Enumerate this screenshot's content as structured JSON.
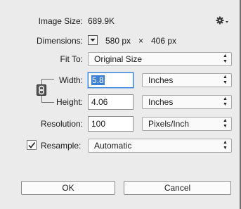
{
  "image_size": {
    "label": "Image Size:",
    "value": "689.9K"
  },
  "settings_icon": "gear-icon",
  "dimensions": {
    "label": "Dimensions:",
    "width": "580 px",
    "times": "×",
    "height": "406 px"
  },
  "fit_to": {
    "label": "Fit To:",
    "value": "Original Size"
  },
  "width": {
    "label": "Width:",
    "value": "5.8",
    "unit": "Inches"
  },
  "height": {
    "label": "Height:",
    "value": "4.06",
    "unit": "Inches"
  },
  "resolution": {
    "label": "Resolution:",
    "value": "100",
    "unit": "Pixels/Inch"
  },
  "resample": {
    "label": "Resample:",
    "checked": true,
    "value": "Automatic"
  },
  "buttons": {
    "ok": "OK",
    "cancel": "Cancel"
  },
  "colors": {
    "background": "#ebebeb",
    "selection": "#3a7fd6",
    "focus": "#2f7bd8"
  }
}
